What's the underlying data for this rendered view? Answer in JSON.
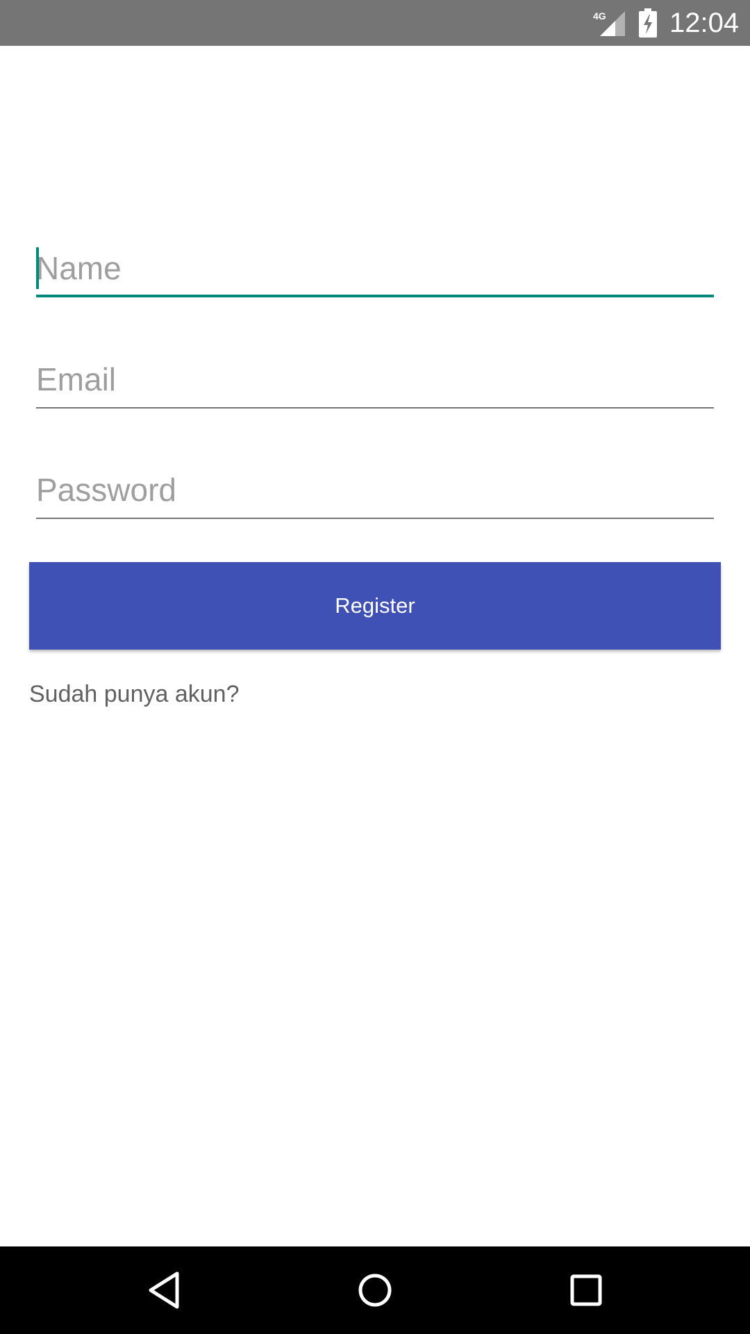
{
  "status_bar": {
    "network_label": "4G",
    "time": "12:04",
    "icons": [
      "signal-4g-icon",
      "battery-charging-icon"
    ]
  },
  "form": {
    "name_placeholder": "Name",
    "email_placeholder": "Email",
    "password_placeholder": "Password",
    "register_label": "Register",
    "login_link": "Sudah punya akun?"
  },
  "nav_bar": {
    "icons": [
      "back-icon",
      "home-icon",
      "recents-icon"
    ]
  },
  "colors": {
    "status_bar": "#757575",
    "accent": "#00897b",
    "primary": "#3f51b5",
    "nav_bar": "#000000"
  }
}
